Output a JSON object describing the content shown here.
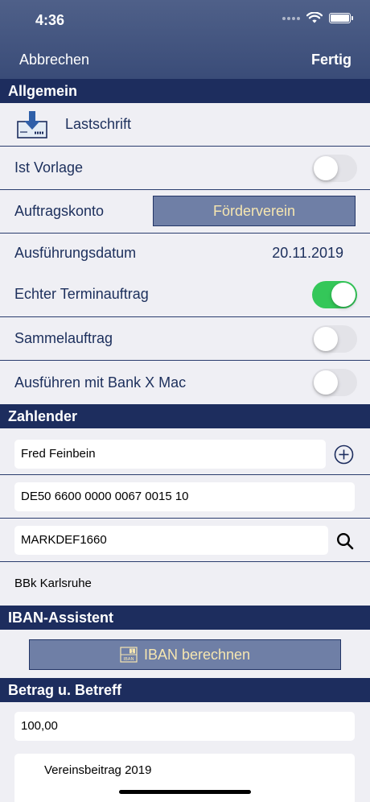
{
  "status_bar": {
    "time": "4:36"
  },
  "nav": {
    "cancel_label": "Abbrechen",
    "done_label": "Fertig"
  },
  "general": {
    "header": "Allgemein",
    "type_label": "Lastschrift",
    "template_label": "Ist Vorlage",
    "template_on": false,
    "account_label": "Auftragskonto",
    "account_value": "Förderverein",
    "date_label": "Ausführungsdatum",
    "date_value": "20.11.2019",
    "scheduled_label": "Echter Terminauftrag",
    "scheduled_on": true,
    "batch_label": "Sammelauftrag",
    "batch_on": false,
    "mac_label": "Ausführen mit Bank X Mac",
    "mac_on": false
  },
  "payer": {
    "header": "Zahlender",
    "name": "Fred Feinbein",
    "iban": "DE50 6600 0000 0067 0015 10",
    "bic": "MARKDEF1660",
    "bank_name": "BBk Karlsruhe"
  },
  "iban_assistant": {
    "header": "IBAN-Assistent",
    "button_label": "IBAN berechnen",
    "icon_text_top": "1",
    "icon_text_bottom": "IBAN"
  },
  "amount": {
    "header": "Betrag u. Betreff",
    "value": "100,00",
    "purpose": "Vereinsbeitrag 2019"
  },
  "colors": {
    "header_bg": "#1d2d5e",
    "toggle_on": "#34c759",
    "button_bg": "#6f7fa6",
    "button_text": "#f6e6b0"
  }
}
